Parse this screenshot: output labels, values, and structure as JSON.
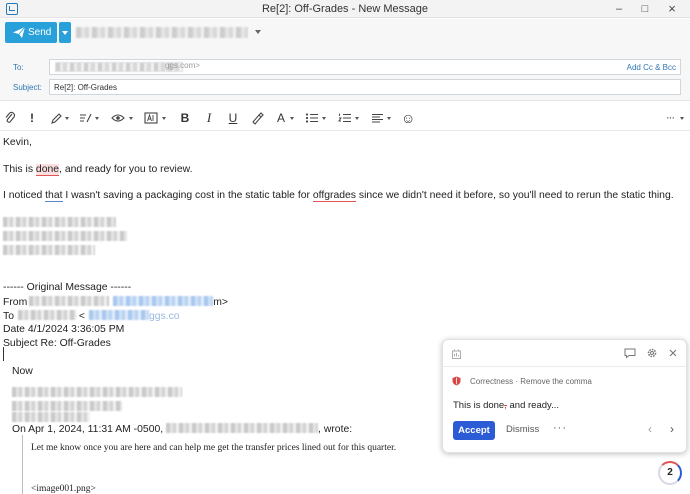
{
  "window": {
    "title": "Re[2]: Off-Grades - New Message",
    "minimize": "–",
    "maximize": "□",
    "close": "×"
  },
  "send": {
    "label": "Send"
  },
  "fields": {
    "to_label": "To:",
    "to_value_suffix": "ggs.com>",
    "add_cc_bcc": "Add Cc & Bcc",
    "subject_label": "Subject:",
    "subject_value": "Re[2]: Off-Grades"
  },
  "toolbar": {
    "important": "!",
    "bold": "B",
    "italic": "I",
    "underline": "U",
    "font_color": "A",
    "emoji": "☺",
    "more": "···"
  },
  "body": {
    "greeting": "Kevin,",
    "line1_pre": "This is ",
    "line1_flag": "done",
    "line1_post": ", and ready for you to review.",
    "line2_pre": "I noticed ",
    "line2_flag": "that",
    "line2_mid": " I wasn't saving a packaging cost in the static table for ",
    "line2_flag2": "offgrades",
    "line2_post": " since we didn't need it before, so you'll need to rerun the static thing.",
    "original_header": "------ Original Message ------",
    "from_label": "From",
    "from_end": "m>",
    "to_label": "To",
    "to_mid": " <",
    "to_end": "ggs.co",
    "date_line": "Date 4/1/2024 3:36:05 PM",
    "subject_line": "Subject Re: Off-Grades",
    "now": "Now",
    "on_pre": "On Apr 1, 2024, 11:31 AM -0500, ",
    "on_post": ", wrote:",
    "quoted": "Let me know once you are here and can help me get the transfer prices lined out for this quarter.",
    "image_tag": "<image001.png>"
  },
  "grammar_card": {
    "category": "Correctness · Remove the comma",
    "suggestion_pre": "This is done",
    "suggestion_removed": ",",
    "suggestion_post": " and ready...",
    "accept": "Accept",
    "dismiss": "Dismiss",
    "more": "···",
    "prev": "‹",
    "next": "›",
    "comment_icon": "comment-icon",
    "settings_icon": "gear-icon",
    "close_icon": "close-icon",
    "brand_color": "#2c5bd6",
    "error_color": "#e05656"
  },
  "badge": {
    "count": "2"
  }
}
